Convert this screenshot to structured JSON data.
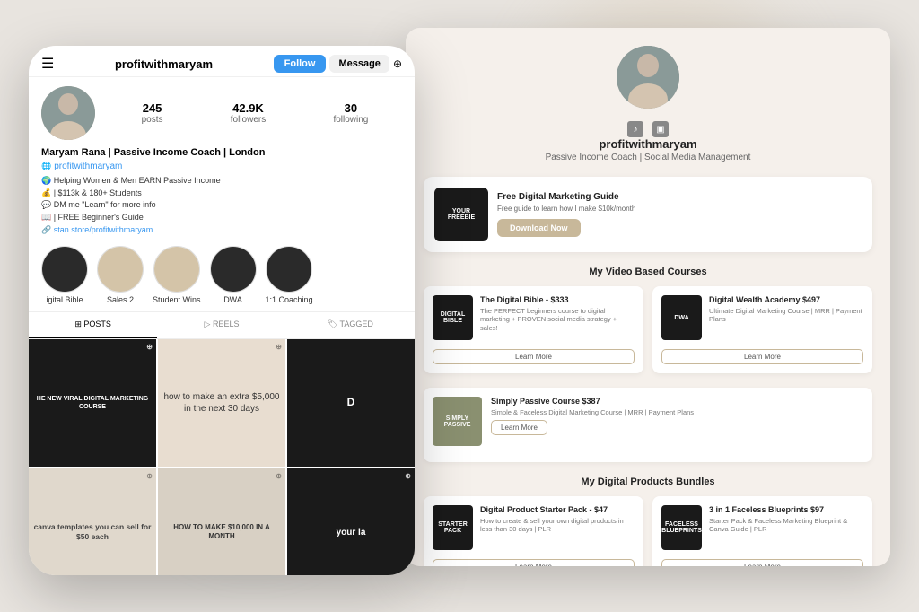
{
  "phone": {
    "username": "profitwithmaryam",
    "follow_label": "Follow",
    "message_label": "Message",
    "stats": {
      "posts_count": "245",
      "posts_label": "posts",
      "followers_count": "42.9K",
      "followers_label": "followers",
      "following_count": "30",
      "following_label": "following"
    },
    "bio": {
      "name": "Maryam Rana | Passive Income Coach | London",
      "website": "profitwithmaryam",
      "lines": [
        "🌍 Helping Women & Men EARN Passive Income",
        "💰 | $113k & 180+ Students",
        "💬 DM me \"Learn\" for more info",
        "📖 | FREE Beginner's Guide",
        "🔗 stan.store/profitwithmaryam"
      ]
    },
    "highlights": [
      {
        "label": "igital Bible",
        "bg": "dark"
      },
      {
        "label": "Sales 2",
        "bg": "beige"
      },
      {
        "label": "Student Wins",
        "bg": "beige"
      },
      {
        "label": "DWA",
        "bg": "dark"
      },
      {
        "label": "1:1 Coaching",
        "bg": "dark"
      }
    ],
    "tabs": [
      {
        "label": "POSTS",
        "active": true
      },
      {
        "label": "REELS",
        "active": false
      },
      {
        "label": "TAGGED",
        "active": false
      }
    ],
    "grid_posts": [
      {
        "text": "HE NEW VIRAL DIGITAL MARKETING COURSE",
        "bg": "dark"
      },
      {
        "text": "how to make an extra $5,000 in the next 30 days",
        "bg": "beige"
      },
      {
        "text": "D",
        "bg": "dark"
      },
      {
        "text": "canva templates you can sell for $50 each",
        "bg": "beige"
      },
      {
        "text": "HOW TO MAKE $10,000 IN A MONTH",
        "bg": "beige"
      },
      {
        "text": "your la",
        "bg": "dark"
      }
    ]
  },
  "stan": {
    "username": "profitwithmaryam",
    "bio": "Passive Income Coach | Social Media Management",
    "freebie": {
      "thumb_text": "YOUR FREEBIE",
      "title": "Free Digital Marketing Guide",
      "desc": "Free guide to learn how I make $10k/month",
      "btn_label": "Download Now"
    },
    "video_courses_title": "My Video Based Courses",
    "courses": [
      {
        "thumb_text": "DIGITAL BIBLE",
        "thumb_bg": "dark",
        "title": "The Digital Bible - $333",
        "desc": "The PERFECT beginners course to digital marketing + PROVEN social media strategy + sales!",
        "btn_label": "Learn More"
      },
      {
        "thumb_text": "DWA",
        "thumb_bg": "dark",
        "title": "Digital Wealth Academy $497",
        "desc": "Ultimate Digital Marketing Course | MRR | Payment Plans",
        "btn_label": "Learn More"
      }
    ],
    "wide_course": {
      "thumb_text": "SIMPLY PASSIVE",
      "thumb_bg": "olive",
      "title": "Simply Passive Course $387",
      "desc": "Simple & Faceless Digital Marketing Course | MRR | Payment Plans",
      "btn_label": "Learn More"
    },
    "products_title": "My Digital Products Bundles",
    "products": [
      {
        "thumb_text": "STARTER PACK",
        "thumb_bg": "dark",
        "title": "Digital Product Starter Pack - $47",
        "desc": "How to create & sell your own digital products in less than 30 days | PLR",
        "btn_label": "Learn More"
      },
      {
        "thumb_text": "FACELESS BLUEPRINTS",
        "thumb_bg": "dark",
        "title": "3 in 1 Faceless Blueprints $97",
        "desc": "Starter Pack & Faceless Marketing Blueprint & Canva Guide | PLR",
        "btn_label": "Learn More"
      }
    ]
  }
}
